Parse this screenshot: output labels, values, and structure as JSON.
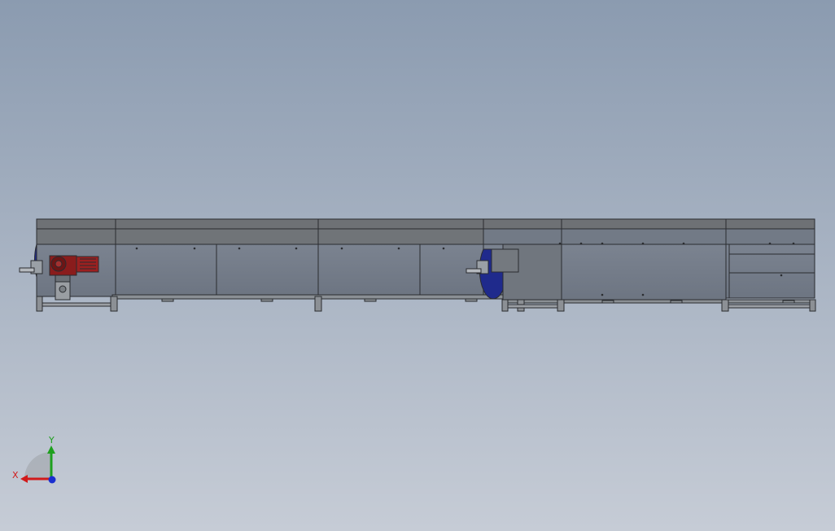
{
  "viewport": {
    "background_top": "#8b9bb0",
    "background_bottom": "#c6ccd6"
  },
  "model": {
    "frame_color": "#6e7479",
    "panel_color": "#737b88",
    "edge_color": "#2a2c30",
    "motor_color": "#8a1c1c",
    "pulley_color": "#1f2a8c"
  },
  "triad": {
    "x_label": "X",
    "y_label": "Y",
    "x_color": "#d11a1a",
    "y_color": "#1ea01e",
    "z_color": "#1a2fd0"
  }
}
